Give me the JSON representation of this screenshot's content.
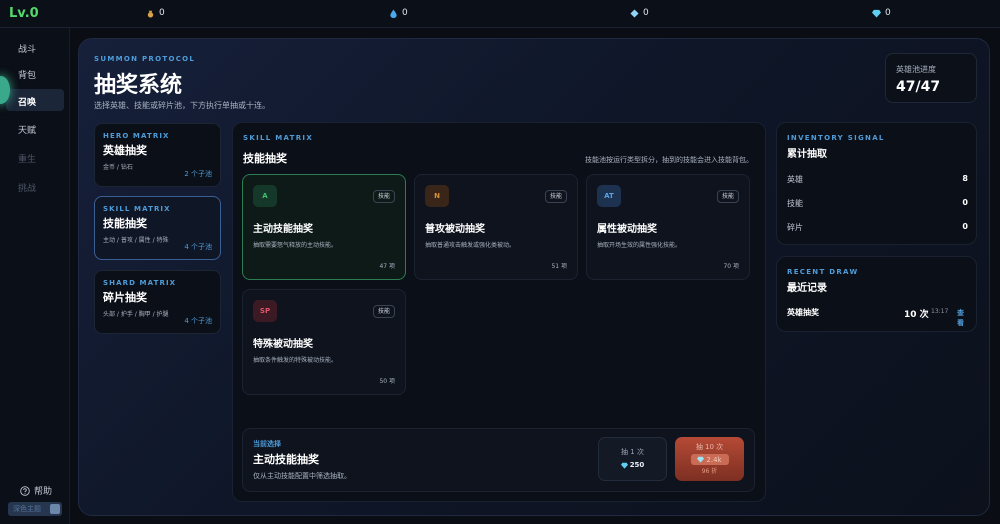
{
  "topbar": {
    "level": "Lv.0",
    "resources": [
      {
        "icon": "bag-icon",
        "value": "0"
      },
      {
        "icon": "drop-icon",
        "value": "0"
      },
      {
        "icon": "crystal-icon",
        "value": "0"
      },
      {
        "icon": "diamond-icon",
        "value": "0"
      }
    ]
  },
  "sidebar": {
    "items": [
      {
        "label": "战斗",
        "state": "normal"
      },
      {
        "label": "背包",
        "state": "normal"
      },
      {
        "label": "召唤",
        "state": "active"
      },
      {
        "label": "天赋",
        "state": "normal"
      },
      {
        "label": "重生",
        "state": "disabled"
      },
      {
        "label": "挑战",
        "state": "disabled"
      }
    ],
    "help": "帮助",
    "theme_toggle": "深色主题"
  },
  "header": {
    "eyebrow": "SUMMON PROTOCOL",
    "title": "抽奖系统",
    "subtitle": "选择英雄、技能或碎片池，下方执行单抽或十连。",
    "progress_label": "英雄池进度",
    "progress_value": "47/47"
  },
  "matrices": [
    {
      "eyebrow": "HERO MATRIX",
      "title": "英雄抽奖",
      "desc": "金币 / 钻石",
      "count": "2 个子池",
      "active": false
    },
    {
      "eyebrow": "SKILL MATRIX",
      "title": "技能抽奖",
      "desc": "主动 / 普攻 / 属性 / 特殊",
      "count": "4 个子池",
      "active": true
    },
    {
      "eyebrow": "SHARD MATRIX",
      "title": "碎片抽奖",
      "desc": "头部 / 护手 / 胸甲 / 护腿",
      "count": "4 个子池",
      "active": false
    }
  ],
  "skill_panel": {
    "eyebrow": "SKILL MATRIX",
    "title": "技能抽奖",
    "note": "技能池按运行类型拆分，抽到的技能会进入技能背包。",
    "cards": [
      {
        "icon": "A",
        "tag": "技能",
        "name": "主动技能抽奖",
        "desc": "抽取需要怒气释放的主动技能。",
        "count": "47 项",
        "color": "#3fbf6e",
        "bg": "#16382a",
        "selected": true
      },
      {
        "icon": "N",
        "tag": "技能",
        "name": "普攻被动抽奖",
        "desc": "抽取普通攻击触发或强化类被动。",
        "count": "51 项",
        "color": "#d9913a",
        "bg": "#3a2618",
        "selected": false
      },
      {
        "icon": "AT",
        "tag": "技能",
        "name": "属性被动抽奖",
        "desc": "抽取开场生效的属性强化技能。",
        "count": "70 项",
        "color": "#5aa2e6",
        "bg": "#1d3250",
        "selected": false
      },
      {
        "icon": "SP",
        "tag": "技能",
        "name": "特殊被动抽奖",
        "desc": "抽取条件触发的特殊被动技能。",
        "count": "50 项",
        "color": "#e0566a",
        "bg": "#3b1a24",
        "selected": false
      }
    ]
  },
  "selection": {
    "eyebrow": "当前选择",
    "name": "主动技能抽奖",
    "desc": "仅从主动技能配置中筛选抽取。",
    "single": {
      "label": "抽 1 次",
      "cost": "250"
    },
    "ten": {
      "label": "抽 10 次",
      "cost": "2.4k",
      "discount": "96 折"
    }
  },
  "inventory": {
    "eyebrow": "INVENTORY SIGNAL",
    "title": "累计抽取",
    "rows": [
      {
        "label": "英雄",
        "value": "8"
      },
      {
        "label": "技能",
        "value": "0"
      },
      {
        "label": "碎片",
        "value": "0"
      }
    ]
  },
  "recent": {
    "eyebrow": "RECENT DRAW",
    "title": "最近记录",
    "row": {
      "name": "英雄抽奖",
      "count": "10 次",
      "time": "13:17",
      "link": "查看"
    }
  }
}
